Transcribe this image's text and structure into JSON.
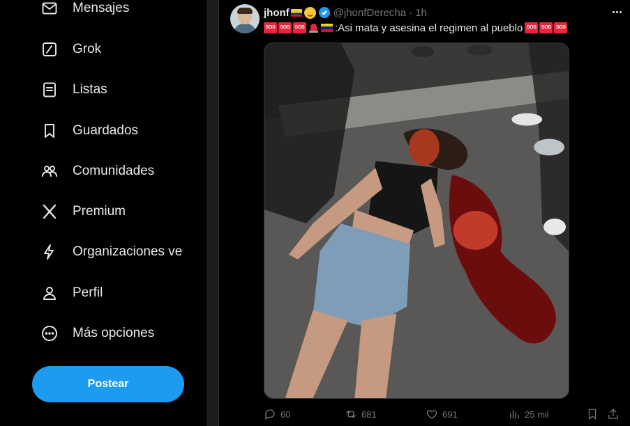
{
  "sidebar": {
    "items": [
      {
        "label": "Mensajes",
        "icon": "envelope-icon"
      },
      {
        "label": "Grok",
        "icon": "grok-icon"
      },
      {
        "label": "Listas",
        "icon": "list-icon"
      },
      {
        "label": "Guardados",
        "icon": "bookmark-icon"
      },
      {
        "label": "Comunidades",
        "icon": "communities-icon"
      },
      {
        "label": "Premium",
        "icon": "x-logo-icon"
      },
      {
        "label": "Organizaciones ve",
        "icon": "lightning-icon"
      },
      {
        "label": "Perfil",
        "icon": "person-icon"
      },
      {
        "label": "Más opciones",
        "icon": "more-circle-icon"
      }
    ],
    "post_button": "Postear"
  },
  "tweet": {
    "name": "jhonf",
    "handle": "@jhonfDerecha",
    "separator": "·",
    "time": "1h",
    "sos_label": "SOS",
    "text": ":Asi mata y asesina el regimen al pueblo",
    "stats": {
      "replies": "60",
      "retweets": "681",
      "likes": "691",
      "views": "25 mil"
    },
    "colors": {
      "accent": "#1d9bf0",
      "sos": "#e8253a",
      "muted": "#71767b"
    }
  }
}
